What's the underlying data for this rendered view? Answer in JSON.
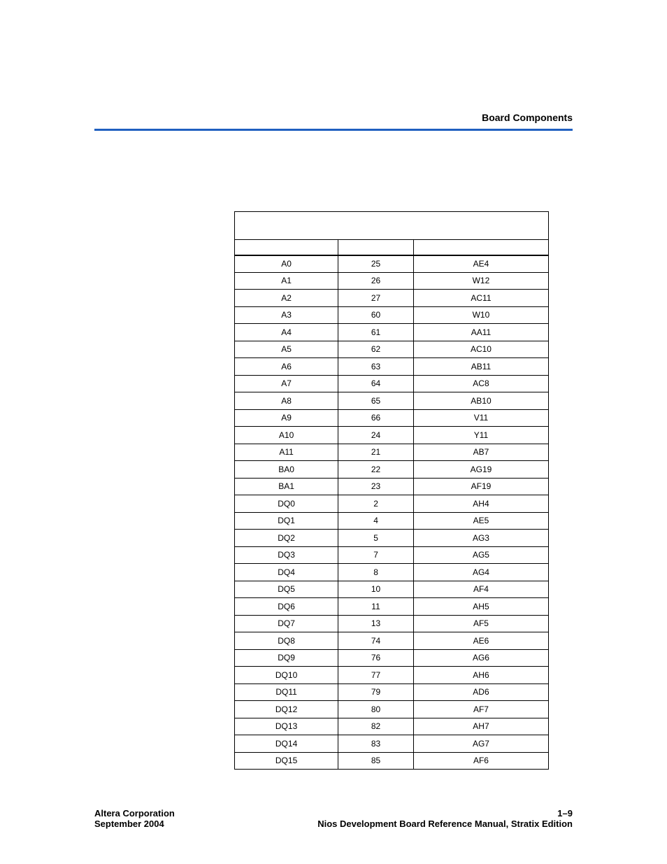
{
  "header": {
    "section_title": "Board Components"
  },
  "table": {
    "rows": [
      {
        "c1": "A0",
        "c2": "25",
        "c3": "AE4"
      },
      {
        "c1": "A1",
        "c2": "26",
        "c3": "W12"
      },
      {
        "c1": "A2",
        "c2": "27",
        "c3": "AC11"
      },
      {
        "c1": "A3",
        "c2": "60",
        "c3": "W10"
      },
      {
        "c1": "A4",
        "c2": "61",
        "c3": "AA11"
      },
      {
        "c1": "A5",
        "c2": "62",
        "c3": "AC10"
      },
      {
        "c1": "A6",
        "c2": "63",
        "c3": "AB11"
      },
      {
        "c1": "A7",
        "c2": "64",
        "c3": "AC8"
      },
      {
        "c1": "A8",
        "c2": "65",
        "c3": "AB10"
      },
      {
        "c1": "A9",
        "c2": "66",
        "c3": "V11"
      },
      {
        "c1": "A10",
        "c2": "24",
        "c3": "Y11"
      },
      {
        "c1": "A11",
        "c2": "21",
        "c3": "AB7"
      },
      {
        "c1": "BA0",
        "c2": "22",
        "c3": "AG19"
      },
      {
        "c1": "BA1",
        "c2": "23",
        "c3": "AF19"
      },
      {
        "c1": "DQ0",
        "c2": "2",
        "c3": "AH4"
      },
      {
        "c1": "DQ1",
        "c2": "4",
        "c3": "AE5"
      },
      {
        "c1": "DQ2",
        "c2": "5",
        "c3": "AG3"
      },
      {
        "c1": "DQ3",
        "c2": "7",
        "c3": "AG5"
      },
      {
        "c1": "DQ4",
        "c2": "8",
        "c3": "AG4"
      },
      {
        "c1": "DQ5",
        "c2": "10",
        "c3": "AF4"
      },
      {
        "c1": "DQ6",
        "c2": "11",
        "c3": "AH5"
      },
      {
        "c1": "DQ7",
        "c2": "13",
        "c3": "AF5"
      },
      {
        "c1": "DQ8",
        "c2": "74",
        "c3": "AE6"
      },
      {
        "c1": "DQ9",
        "c2": "76",
        "c3": "AG6"
      },
      {
        "c1": "DQ10",
        "c2": "77",
        "c3": "AH6"
      },
      {
        "c1": "DQ11",
        "c2": "79",
        "c3": "AD6"
      },
      {
        "c1": "DQ12",
        "c2": "80",
        "c3": "AF7"
      },
      {
        "c1": "DQ13",
        "c2": "82",
        "c3": "AH7"
      },
      {
        "c1": "DQ14",
        "c2": "83",
        "c3": "AG7"
      },
      {
        "c1": "DQ15",
        "c2": "85",
        "c3": "AF6"
      }
    ]
  },
  "footer": {
    "company": "Altera Corporation",
    "date": "September 2004",
    "page_number": "1–9",
    "manual_title": "Nios Development Board Reference Manual, Stratix Edition"
  }
}
